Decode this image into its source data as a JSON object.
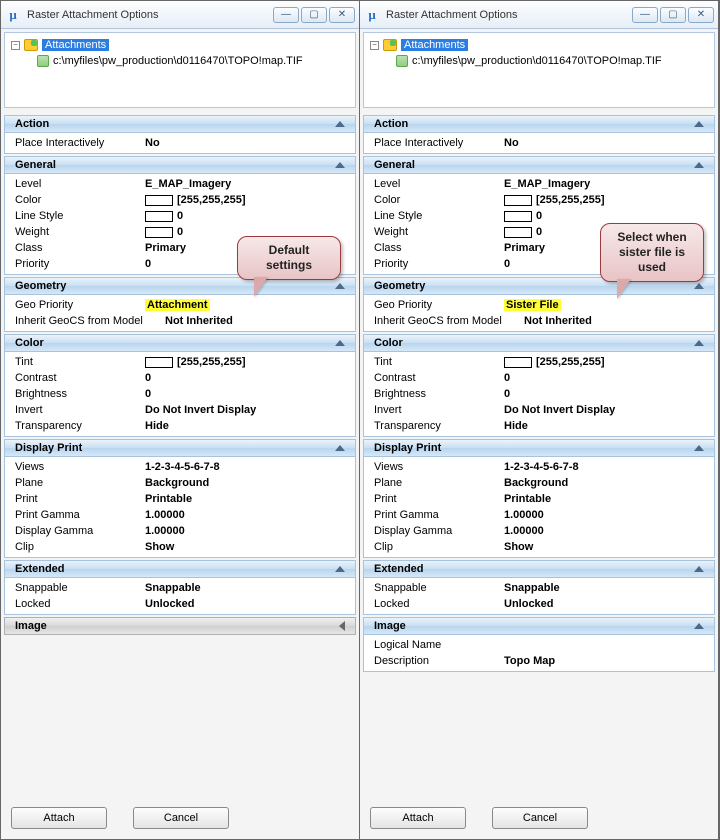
{
  "left": {
    "title": "Raster Attachment Options",
    "tree": {
      "root": "Attachments",
      "path": "c:\\myfiles\\pw_production\\d0116470\\TOPO!map.TIF"
    },
    "callout": "Default settings",
    "sections": {
      "action": {
        "title": "Action",
        "place_lbl": "Place Interactively",
        "place_val": "No"
      },
      "general": {
        "title": "General",
        "level_lbl": "Level",
        "level_val": "E_MAP_Imagery",
        "color_lbl": "Color",
        "color_val": "[255,255,255]",
        "ls_lbl": "Line Style",
        "ls_val": "0",
        "wt_lbl": "Weight",
        "wt_val": "0",
        "class_lbl": "Class",
        "class_val": "Primary",
        "prio_lbl": "Priority",
        "prio_val": "0"
      },
      "geometry": {
        "title": "Geometry",
        "gp_lbl": "Geo Priority",
        "gp_val": "Attachment",
        "ig_lbl": "Inherit GeoCS from Model",
        "ig_val": "Not Inherited"
      },
      "color": {
        "title": "Color",
        "tint_lbl": "Tint",
        "tint_val": "[255,255,255]",
        "con_lbl": "Contrast",
        "con_val": "0",
        "bri_lbl": "Brightness",
        "bri_val": "0",
        "inv_lbl": "Invert",
        "inv_val": "Do Not Invert Display",
        "tra_lbl": "Transparency",
        "tra_val": "Hide"
      },
      "dprint": {
        "title": "Display Print",
        "views_lbl": "Views",
        "views_val": "1-2-3-4-5-6-7-8",
        "plane_lbl": "Plane",
        "plane_val": "Background",
        "print_lbl": "Print",
        "print_val": "Printable",
        "pg_lbl": "Print Gamma",
        "pg_val": "1.00000",
        "dg_lbl": "Display Gamma",
        "dg_val": "1.00000",
        "clip_lbl": "Clip",
        "clip_val": "Show"
      },
      "extended": {
        "title": "Extended",
        "snap_lbl": "Snappable",
        "snap_val": "Snappable",
        "lock_lbl": "Locked",
        "lock_val": "Unlocked"
      },
      "image": {
        "title": "Image"
      }
    },
    "buttons": {
      "attach": "Attach",
      "cancel": "Cancel"
    }
  },
  "right": {
    "title": "Raster Attachment Options",
    "tree": {
      "root": "Attachments",
      "path": "c:\\myfiles\\pw_production\\d0116470\\TOPO!map.TIF"
    },
    "callout": "Select when sister file is used",
    "sections": {
      "action": {
        "title": "Action",
        "place_lbl": "Place Interactively",
        "place_val": "No"
      },
      "general": {
        "title": "General",
        "level_lbl": "Level",
        "level_val": "E_MAP_Imagery",
        "color_lbl": "Color",
        "color_val": "[255,255,255]",
        "ls_lbl": "Line Style",
        "ls_val": "0",
        "wt_lbl": "Weight",
        "wt_val": "0",
        "class_lbl": "Class",
        "class_val": "Primary",
        "prio_lbl": "Priority",
        "prio_val": "0"
      },
      "geometry": {
        "title": "Geometry",
        "gp_lbl": "Geo Priority",
        "gp_val": "Sister File",
        "ig_lbl": "Inherit GeoCS from Model",
        "ig_val": "Not Inherited"
      },
      "color": {
        "title": "Color",
        "tint_lbl": "Tint",
        "tint_val": "[255,255,255]",
        "con_lbl": "Contrast",
        "con_val": "0",
        "bri_lbl": "Brightness",
        "bri_val": "0",
        "inv_lbl": "Invert",
        "inv_val": "Do Not Invert Display",
        "tra_lbl": "Transparency",
        "tra_val": "Hide"
      },
      "dprint": {
        "title": "Display Print",
        "views_lbl": "Views",
        "views_val": "1-2-3-4-5-6-7-8",
        "plane_lbl": "Plane",
        "plane_val": "Background",
        "print_lbl": "Print",
        "print_val": "Printable",
        "pg_lbl": "Print Gamma",
        "pg_val": "1.00000",
        "dg_lbl": "Display Gamma",
        "dg_val": "1.00000",
        "clip_lbl": "Clip",
        "clip_val": "Show"
      },
      "extended": {
        "title": "Extended",
        "snap_lbl": "Snappable",
        "snap_val": "Snappable",
        "lock_lbl": "Locked",
        "lock_val": "Unlocked"
      },
      "image": {
        "title": "Image",
        "ln_lbl": "Logical Name",
        "ln_val": "",
        "desc_lbl": "Description",
        "desc_val": "Topo Map"
      }
    },
    "buttons": {
      "attach": "Attach",
      "cancel": "Cancel"
    }
  }
}
